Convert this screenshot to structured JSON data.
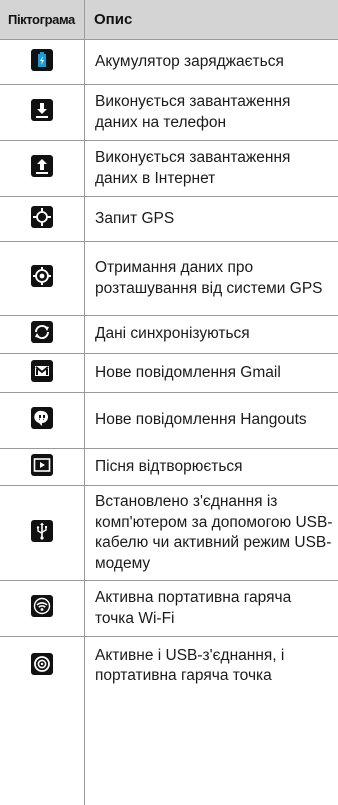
{
  "header": {
    "col_icon": "Піктограма",
    "col_desc": "Опис"
  },
  "rows": [
    {
      "icon": "battery-charging-icon",
      "text": "Акумулятор заряджається"
    },
    {
      "icon": "download-icon",
      "text": "Виконується завантаження даних на телефон"
    },
    {
      "icon": "upload-icon",
      "text": "Виконується завантаження даних в Інтернет"
    },
    {
      "icon": "gps-request-icon",
      "text": "Запит GPS"
    },
    {
      "icon": "gps-location-icon",
      "text": "Отримання даних про розташування від системи GPS"
    },
    {
      "icon": "sync-icon",
      "text": "Дані синхронізуються"
    },
    {
      "icon": "gmail-icon",
      "text": "Нове повідомлення Gmail"
    },
    {
      "icon": "hangouts-icon",
      "text": "Нове повідомлення Hangouts"
    },
    {
      "icon": "play-icon",
      "text": "Пісня відтворюється"
    },
    {
      "icon": "usb-icon",
      "text": "Встановлено з'єднання із комп'ютером за допомогою USB-кабелю чи активний режим USB-модему"
    },
    {
      "icon": "wifi-hotspot-icon",
      "text": "Активна портативна гаряча точка Wi-Fi"
    },
    {
      "icon": "usb-and-hotspot-icon",
      "text": "Активне і USB-з'єднання, і портативна гаряча точка"
    }
  ],
  "colors": {
    "header_bg": "#d4d4d4",
    "grid": "#9a9a9a",
    "icon_bg": "#111111",
    "battery_accent": "#1e9bd7"
  }
}
